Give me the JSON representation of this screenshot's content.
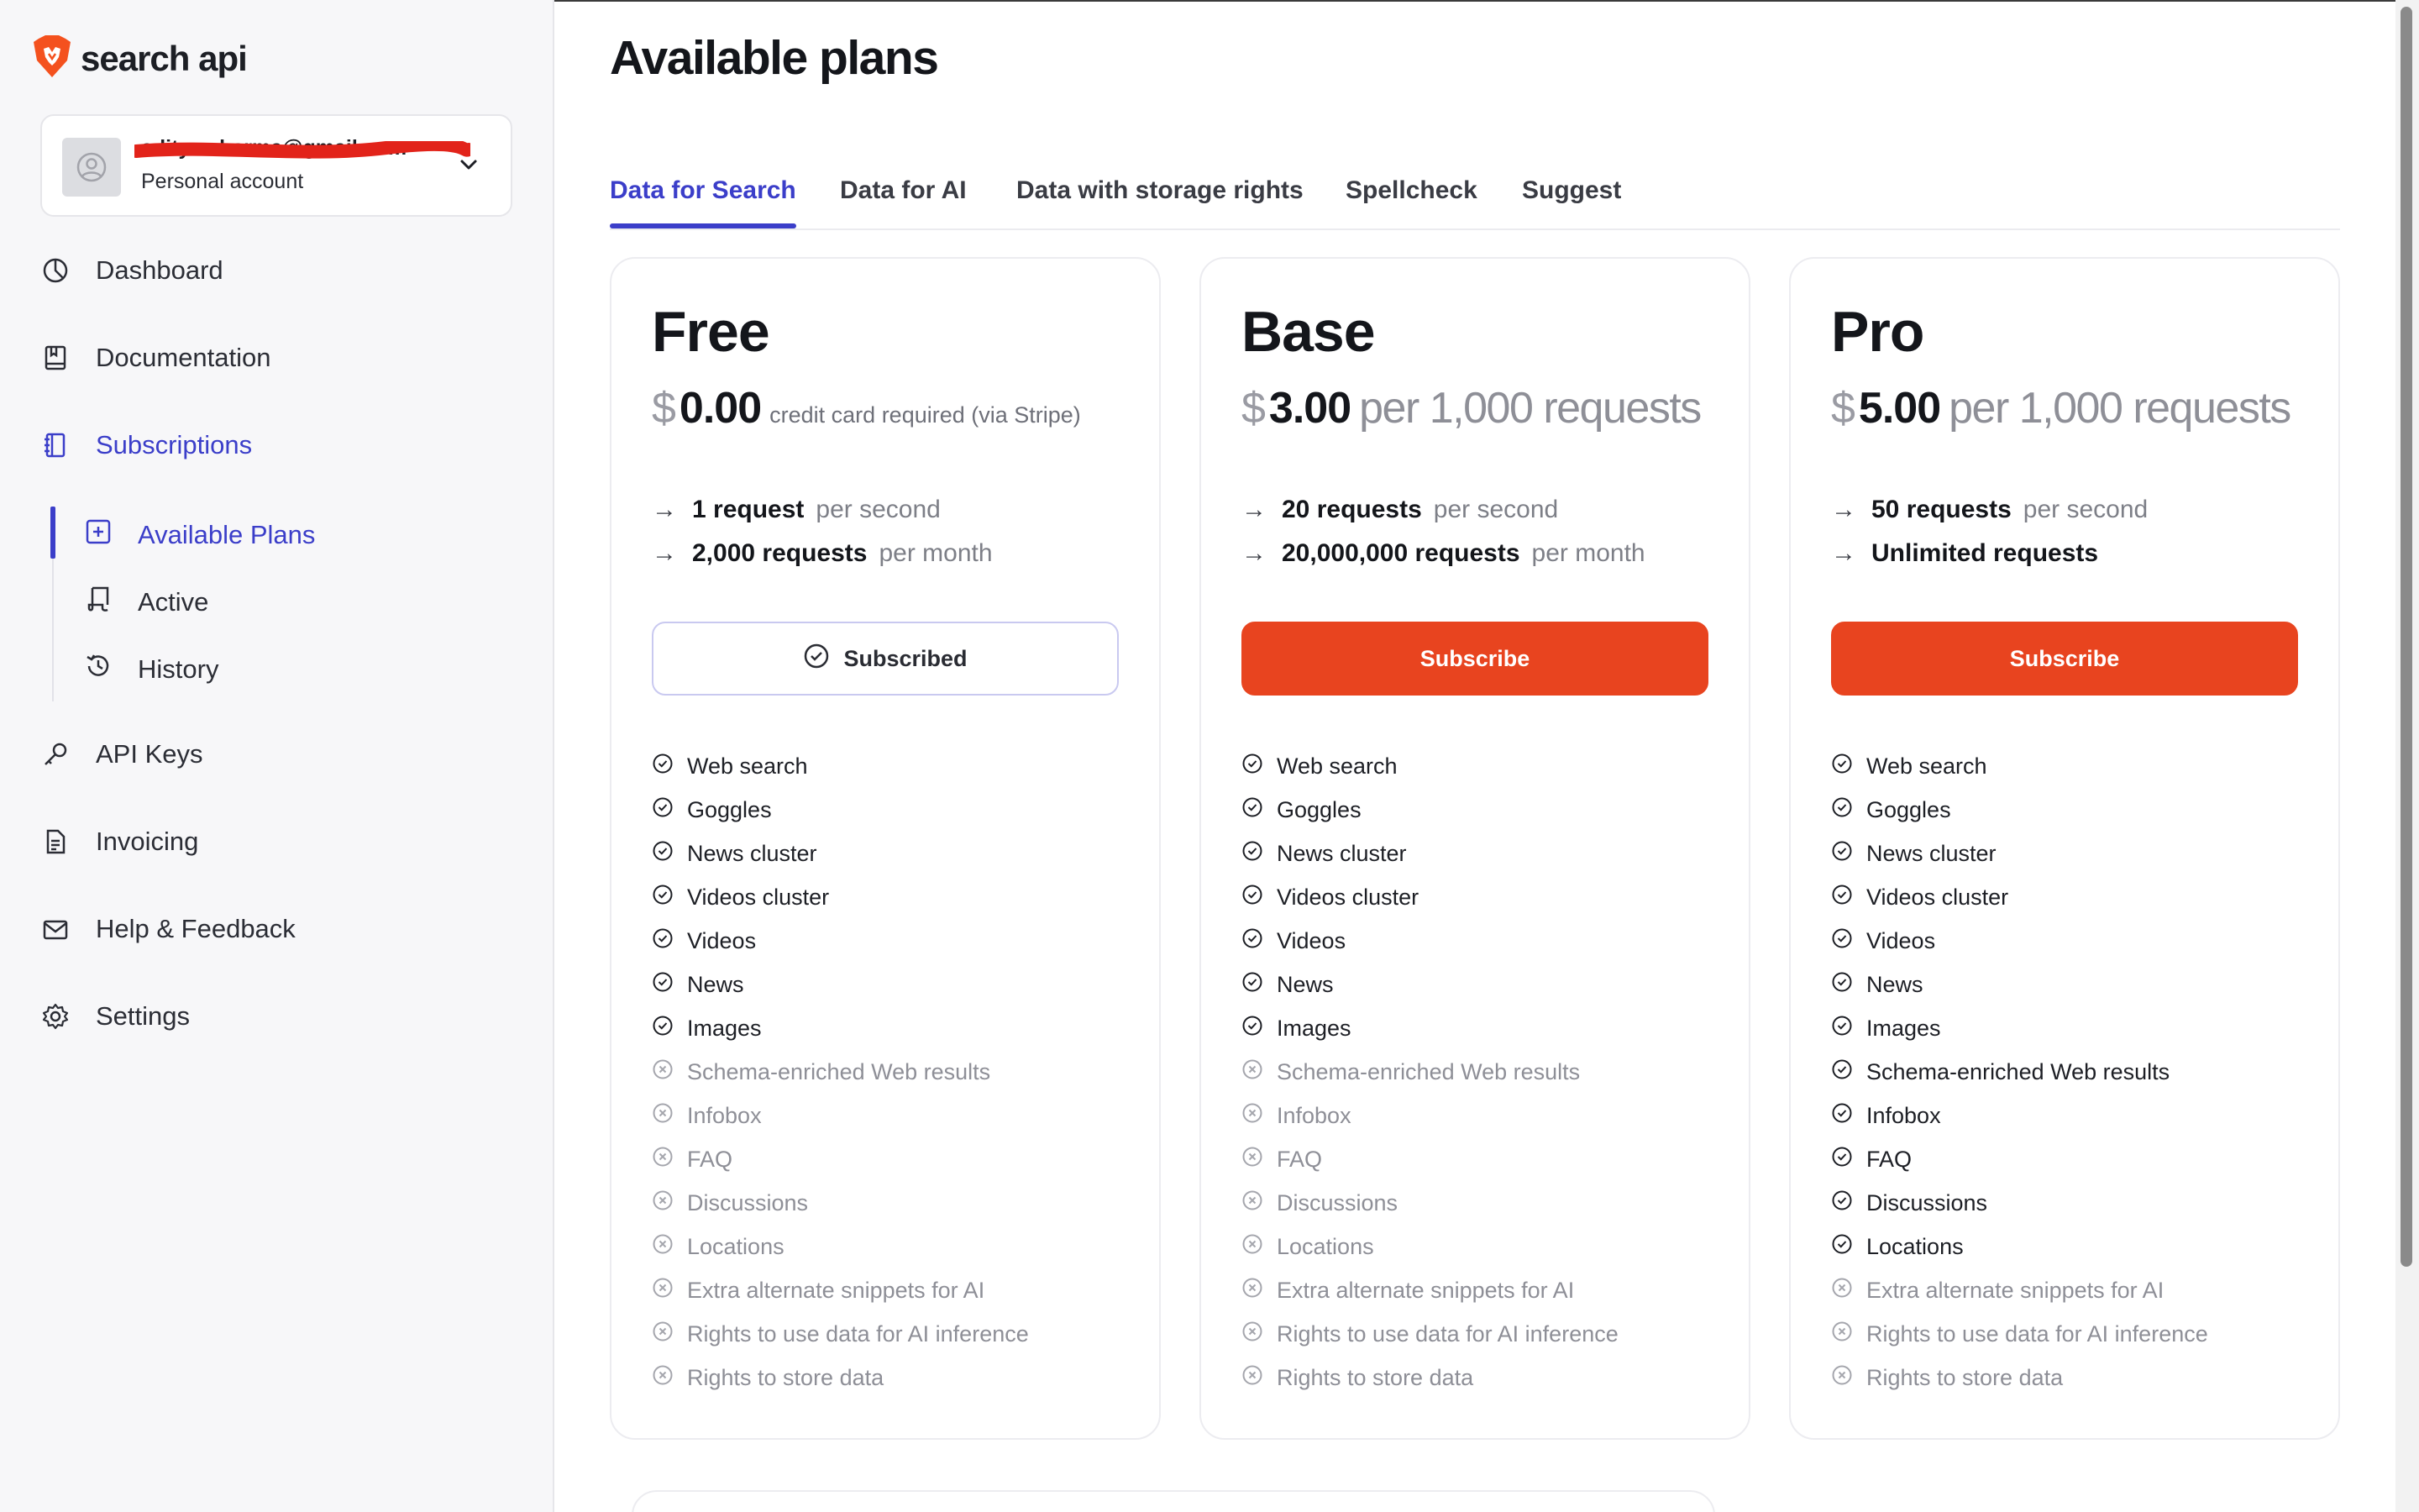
{
  "app": {
    "logo_text": "search api"
  },
  "account": {
    "email": "aditya.sharma@gmail.com",
    "type": "Personal account"
  },
  "nav": {
    "dashboard": "Dashboard",
    "documentation": "Documentation",
    "subscriptions": "Subscriptions",
    "available_plans": "Available Plans",
    "active": "Active",
    "history": "History",
    "api_keys": "API Keys",
    "invoicing": "Invoicing",
    "help": "Help & Feedback",
    "settings": "Settings"
  },
  "page": {
    "title": "Available plans"
  },
  "tabs": [
    "Data for Search",
    "Data for AI",
    "Data with storage rights",
    "Spellcheck",
    "Suggest"
  ],
  "plans": [
    {
      "name": "Free",
      "currency": "$",
      "amount": "0.00",
      "price_note": "credit card required (via Stripe)",
      "rate_strong": "1 request",
      "rate_weak": "per second",
      "volume_strong": "2,000 requests",
      "volume_weak": "per month",
      "button": "Subscribed",
      "features_on": [
        "Web search",
        "Goggles",
        "News cluster",
        "Videos cluster",
        "Videos",
        "News",
        "Images"
      ],
      "features_off": [
        "Schema-enriched Web results",
        "Infobox",
        "FAQ",
        "Discussions",
        "Locations",
        "Extra alternate snippets for AI",
        "Rights to use data for AI inference",
        "Rights to store data"
      ]
    },
    {
      "name": "Base",
      "currency": "$",
      "amount": "3.00",
      "price_per": "per 1,000 requests",
      "rate_strong": "20 requests",
      "rate_weak": "per second",
      "volume_strong": "20,000,000 requests",
      "volume_weak": "per month",
      "button": "Subscribe",
      "features_on": [
        "Web search",
        "Goggles",
        "News cluster",
        "Videos cluster",
        "Videos",
        "News",
        "Images"
      ],
      "features_off": [
        "Schema-enriched Web results",
        "Infobox",
        "FAQ",
        "Discussions",
        "Locations",
        "Extra alternate snippets for AI",
        "Rights to use data for AI inference",
        "Rights to store data"
      ]
    },
    {
      "name": "Pro",
      "currency": "$",
      "amount": "5.00",
      "price_per": "per 1,000 requests",
      "rate_strong": "50 requests",
      "rate_weak": "per second",
      "volume_strong": "Unlimited requests",
      "button": "Subscribe",
      "features_on": [
        "Web search",
        "Goggles",
        "News cluster",
        "Videos cluster",
        "Videos",
        "News",
        "Images",
        "Schema-enriched Web results",
        "Infobox",
        "FAQ",
        "Discussions",
        "Locations"
      ],
      "features_off": [
        "Extra alternate snippets for AI",
        "Rights to use data for AI inference",
        "Rights to store data"
      ]
    }
  ],
  "colors": {
    "accent": "#3b3ec9",
    "brand": "#e8441f",
    "muted": "#8e8f97"
  }
}
